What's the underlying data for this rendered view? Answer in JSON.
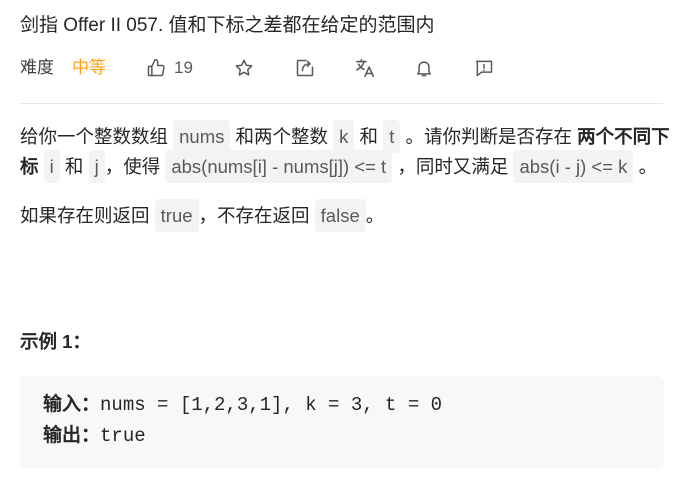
{
  "problem": {
    "title": "剑指 Offer II 057. 值和下标之差都在给定的范围内",
    "difficulty_label": "难度",
    "difficulty_value": "中等",
    "likes": "19"
  },
  "toolbar": {
    "icons": [
      "thumbs-up-icon",
      "star-icon",
      "share-icon",
      "translate-icon",
      "bell-icon",
      "feedback-icon"
    ]
  },
  "description": {
    "p1_a": "给你一个整数数组 ",
    "p1_nums": "nums",
    "p1_b": " 和两个整数 ",
    "p1_k": "k",
    "p1_c": " 和 ",
    "p1_t": "t",
    "p1_d": " 。请你判断是否存在 ",
    "p1_bold": "两个不同下标",
    "p1_e": " ",
    "p1_i": "i",
    "p1_f": " 和 ",
    "p1_j": "j",
    "p1_g": "，使得 ",
    "p1_expr1": "abs(nums[i] - nums[j]) <= t",
    "p1_h": " ，同时又满足 ",
    "p1_expr2": "abs(i - j) <= k",
    "p1_end": " 。",
    "p2_a": "如果存在则返回 ",
    "p2_true": "true",
    "p2_b": "，不存在返回 ",
    "p2_false": "false",
    "p2_end": "。"
  },
  "example1": {
    "title": "示例 1：",
    "input_label": "输入：",
    "input_value": "nums = [1,2,3,1], k = 3, t = 0",
    "output_label": "输出：",
    "output_value": "true"
  },
  "colors": {
    "difficulty_medium": "#ffa116",
    "code_bg": "#f3f3f3",
    "example_bg": "#f7f8fa"
  }
}
